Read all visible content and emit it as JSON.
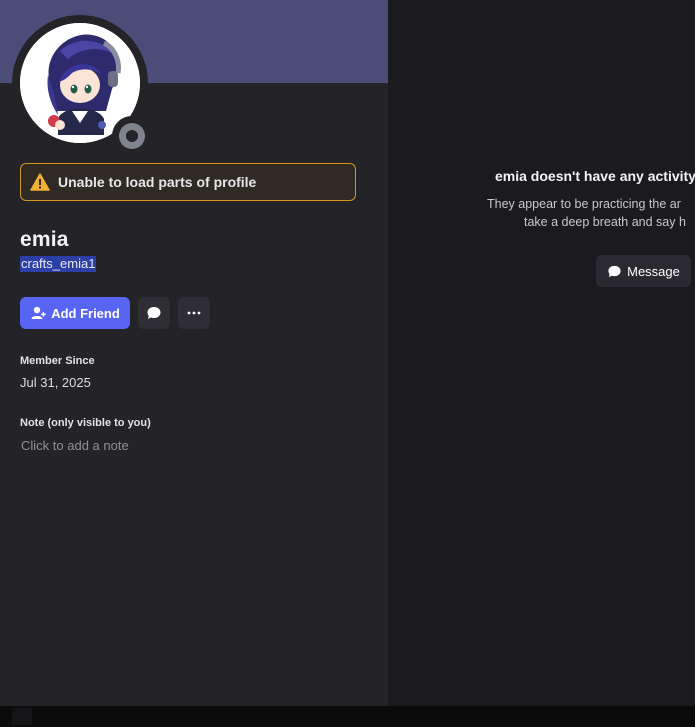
{
  "profile": {
    "display_name": "emia",
    "username": "crafts_emia1",
    "avatar_icon": "anime-avatar",
    "status": "offline",
    "banner_color": "#4c4c78"
  },
  "warning": {
    "text": "Unable to load parts of profile",
    "icon": "warning-triangle-icon",
    "color": "#d29822"
  },
  "actions": {
    "add_friend_label": "Add Friend",
    "message_icon": "chat-bubble-icon",
    "more_icon": "ellipsis-icon",
    "accent": "#5865f2"
  },
  "member_since": {
    "label": "Member Since",
    "value": "Jul 31, 2025"
  },
  "note": {
    "label": "Note (only visible to you)",
    "placeholder": "Click to add a note"
  },
  "activity": {
    "title": "emia doesn't have any activity",
    "line1": "They appear to be practicing the ar",
    "line2": "take a deep breath and say h",
    "message_label": "Message"
  }
}
